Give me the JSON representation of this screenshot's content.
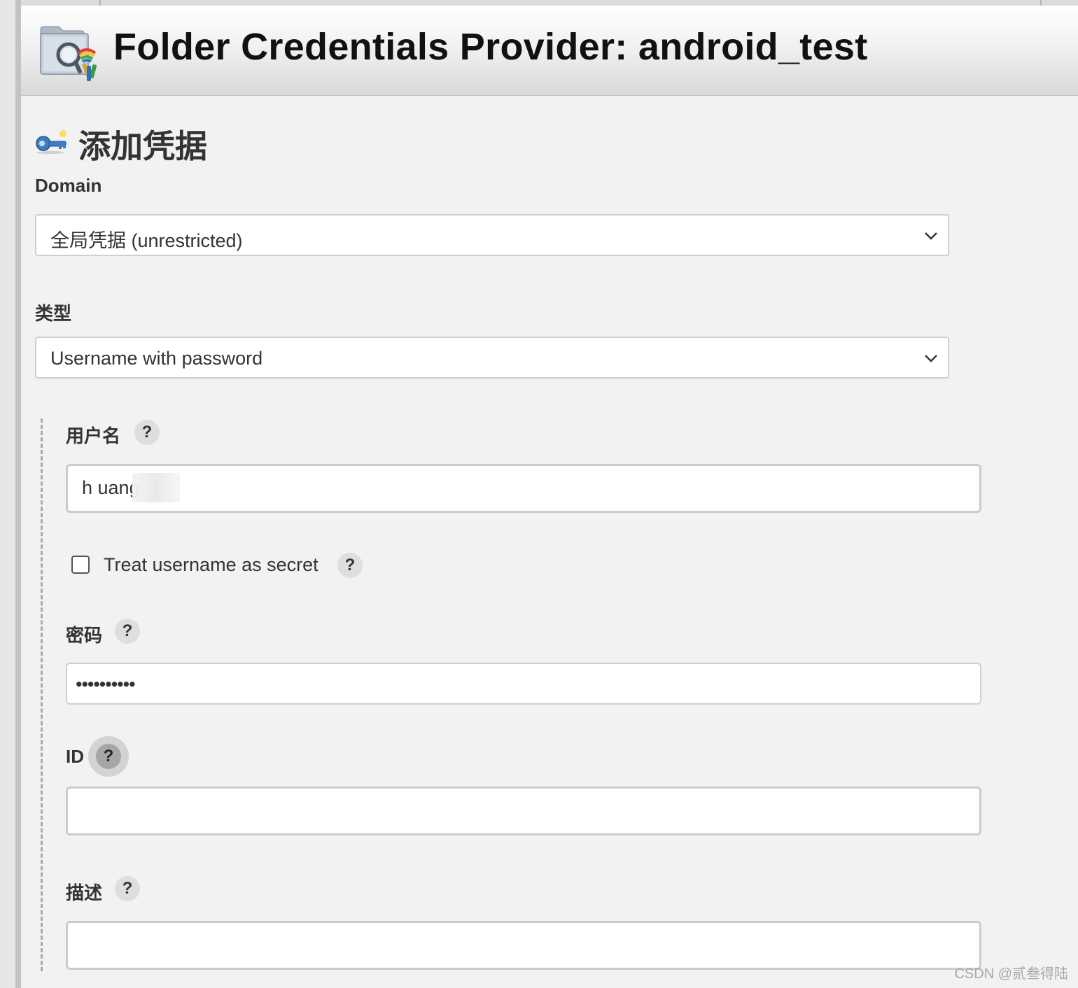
{
  "page": {
    "title": "Folder Credentials Provider: android_test",
    "section_title": "添加凭据"
  },
  "domain": {
    "label": "Domain",
    "selected": "全局凭据 (unrestricted)"
  },
  "kind": {
    "label": "类型",
    "selected": "Username with password"
  },
  "username": {
    "label": "用户名",
    "value": "h      uang",
    "help": "?"
  },
  "treat_secret": {
    "label": "Treat username as secret",
    "checked": false,
    "help": "?"
  },
  "password": {
    "label": "密码",
    "value": "••••••••••",
    "help": "?"
  },
  "id": {
    "label": "ID",
    "value": "",
    "help": "?"
  },
  "description": {
    "label": "描述",
    "value": "",
    "help": "?"
  },
  "watermark": "CSDN @贰叁得陆"
}
